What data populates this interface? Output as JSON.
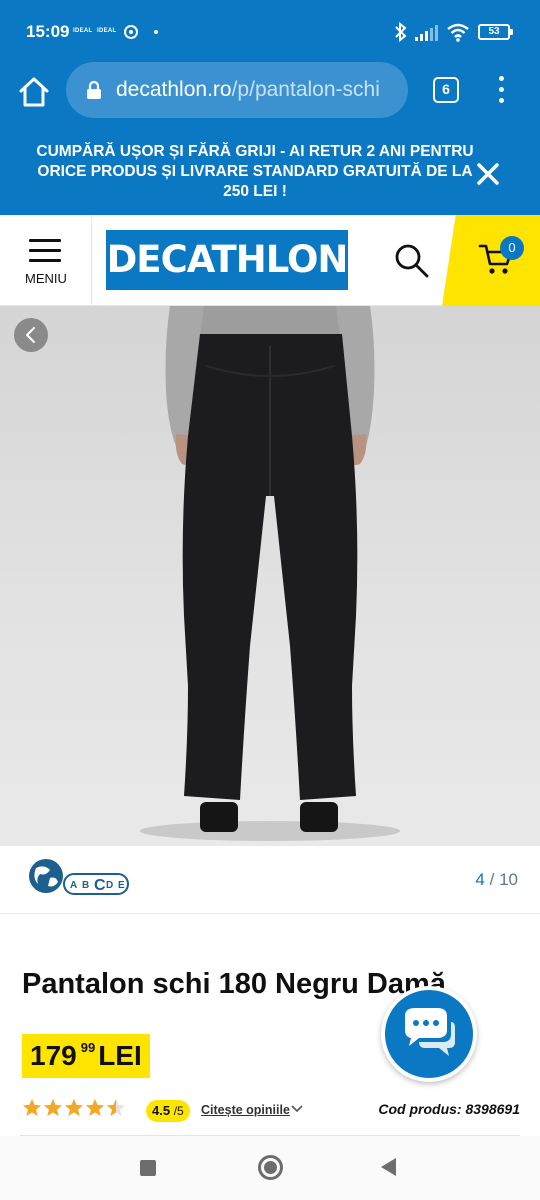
{
  "status_bar": {
    "time": "15:09",
    "carrier1": "IDEAL",
    "carrier2": "IDEAL",
    "battery": "53"
  },
  "browser": {
    "url_domain": "decathlon.ro",
    "url_path": "/p/pantalon-schi",
    "tab_count": "6"
  },
  "promo": {
    "text": "CUMPĂRĂ UȘOR ȘI FĂRĂ GRIJI - AI RETUR 2 ANI PENTRU ORICE PRODUS ȘI LIVRARE STANDARD GRATUITĂ DE LA 250 LEI !"
  },
  "header": {
    "menu_label": "MENIU",
    "logo_text": "DECATHLON",
    "cart_count": "0"
  },
  "gallery": {
    "current": "4",
    "separator": "/",
    "total": "10"
  },
  "eco_badge": {
    "letters": [
      "A",
      "B",
      "C",
      "D",
      "E"
    ]
  },
  "product": {
    "title": "Pantalon schi 180 Negru Damă",
    "price_int": "179",
    "price_dec": "99",
    "currency": "LEI",
    "rating": "4.5",
    "rating_max": "/5",
    "rating_value": 4.5,
    "reviews_link": "Citește opiniile",
    "code": "Cod produs: 8398691"
  },
  "colors": {
    "brand_blue": "#0a78c2",
    "accent_yellow": "#ffe400",
    "star_orange": "#f5a623"
  },
  "icons": {
    "home": "home-icon",
    "lock": "lock-icon",
    "tabs": "tabs-icon",
    "menu": "more-vert-icon",
    "close": "close-icon",
    "hamburger": "hamburger-icon",
    "search": "search-icon",
    "cart": "cart-icon",
    "chat": "chat-icon",
    "prev": "chevron-left-icon",
    "chevron": "chevron-down-icon"
  }
}
